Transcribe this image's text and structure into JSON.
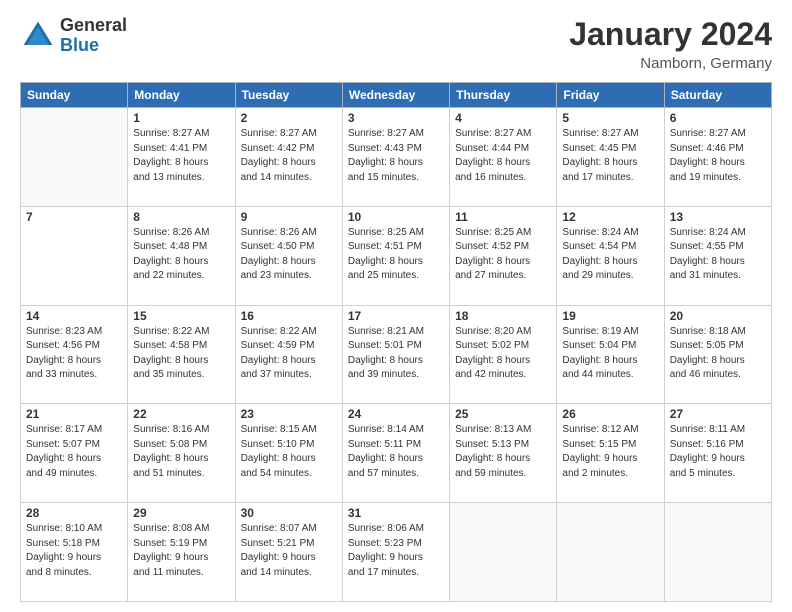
{
  "logo": {
    "general": "General",
    "blue": "Blue"
  },
  "title": "January 2024",
  "location": "Namborn, Germany",
  "days_of_week": [
    "Sunday",
    "Monday",
    "Tuesday",
    "Wednesday",
    "Thursday",
    "Friday",
    "Saturday"
  ],
  "weeks": [
    [
      {
        "day": "",
        "content": ""
      },
      {
        "day": "1",
        "content": "Sunrise: 8:27 AM\nSunset: 4:41 PM\nDaylight: 8 hours\nand 13 minutes."
      },
      {
        "day": "2",
        "content": "Sunrise: 8:27 AM\nSunset: 4:42 PM\nDaylight: 8 hours\nand 14 minutes."
      },
      {
        "day": "3",
        "content": "Sunrise: 8:27 AM\nSunset: 4:43 PM\nDaylight: 8 hours\nand 15 minutes."
      },
      {
        "day": "4",
        "content": "Sunrise: 8:27 AM\nSunset: 4:44 PM\nDaylight: 8 hours\nand 16 minutes."
      },
      {
        "day": "5",
        "content": "Sunrise: 8:27 AM\nSunset: 4:45 PM\nDaylight: 8 hours\nand 17 minutes."
      },
      {
        "day": "6",
        "content": "Sunrise: 8:27 AM\nSunset: 4:46 PM\nDaylight: 8 hours\nand 19 minutes."
      }
    ],
    [
      {
        "day": "7",
        "content": ""
      },
      {
        "day": "8",
        "content": "Sunrise: 8:26 AM\nSunset: 4:48 PM\nDaylight: 8 hours\nand 22 minutes."
      },
      {
        "day": "9",
        "content": "Sunrise: 8:26 AM\nSunset: 4:50 PM\nDaylight: 8 hours\nand 23 minutes."
      },
      {
        "day": "10",
        "content": "Sunrise: 8:25 AM\nSunset: 4:51 PM\nDaylight: 8 hours\nand 25 minutes."
      },
      {
        "day": "11",
        "content": "Sunrise: 8:25 AM\nSunset: 4:52 PM\nDaylight: 8 hours\nand 27 minutes."
      },
      {
        "day": "12",
        "content": "Sunrise: 8:24 AM\nSunset: 4:54 PM\nDaylight: 8 hours\nand 29 minutes."
      },
      {
        "day": "13",
        "content": "Sunrise: 8:24 AM\nSunset: 4:55 PM\nDaylight: 8 hours\nand 31 minutes."
      }
    ],
    [
      {
        "day": "14",
        "content": "Sunrise: 8:23 AM\nSunset: 4:56 PM\nDaylight: 8 hours\nand 33 minutes."
      },
      {
        "day": "15",
        "content": "Sunrise: 8:22 AM\nSunset: 4:58 PM\nDaylight: 8 hours\nand 35 minutes."
      },
      {
        "day": "16",
        "content": "Sunrise: 8:22 AM\nSunset: 4:59 PM\nDaylight: 8 hours\nand 37 minutes."
      },
      {
        "day": "17",
        "content": "Sunrise: 8:21 AM\nSunset: 5:01 PM\nDaylight: 8 hours\nand 39 minutes."
      },
      {
        "day": "18",
        "content": "Sunrise: 8:20 AM\nSunset: 5:02 PM\nDaylight: 8 hours\nand 42 minutes."
      },
      {
        "day": "19",
        "content": "Sunrise: 8:19 AM\nSunset: 5:04 PM\nDaylight: 8 hours\nand 44 minutes."
      },
      {
        "day": "20",
        "content": "Sunrise: 8:18 AM\nSunset: 5:05 PM\nDaylight: 8 hours\nand 46 minutes."
      }
    ],
    [
      {
        "day": "21",
        "content": "Sunrise: 8:17 AM\nSunset: 5:07 PM\nDaylight: 8 hours\nand 49 minutes."
      },
      {
        "day": "22",
        "content": "Sunrise: 8:16 AM\nSunset: 5:08 PM\nDaylight: 8 hours\nand 51 minutes."
      },
      {
        "day": "23",
        "content": "Sunrise: 8:15 AM\nSunset: 5:10 PM\nDaylight: 8 hours\nand 54 minutes."
      },
      {
        "day": "24",
        "content": "Sunrise: 8:14 AM\nSunset: 5:11 PM\nDaylight: 8 hours\nand 57 minutes."
      },
      {
        "day": "25",
        "content": "Sunrise: 8:13 AM\nSunset: 5:13 PM\nDaylight: 8 hours\nand 59 minutes."
      },
      {
        "day": "26",
        "content": "Sunrise: 8:12 AM\nSunset: 5:15 PM\nDaylight: 9 hours\nand 2 minutes."
      },
      {
        "day": "27",
        "content": "Sunrise: 8:11 AM\nSunset: 5:16 PM\nDaylight: 9 hours\nand 5 minutes."
      }
    ],
    [
      {
        "day": "28",
        "content": "Sunrise: 8:10 AM\nSunset: 5:18 PM\nDaylight: 9 hours\nand 8 minutes."
      },
      {
        "day": "29",
        "content": "Sunrise: 8:08 AM\nSunset: 5:19 PM\nDaylight: 9 hours\nand 11 minutes."
      },
      {
        "day": "30",
        "content": "Sunrise: 8:07 AM\nSunset: 5:21 PM\nDaylight: 9 hours\nand 14 minutes."
      },
      {
        "day": "31",
        "content": "Sunrise: 8:06 AM\nSunset: 5:23 PM\nDaylight: 9 hours\nand 17 minutes."
      },
      {
        "day": "",
        "content": ""
      },
      {
        "day": "",
        "content": ""
      },
      {
        "day": "",
        "content": ""
      }
    ]
  ]
}
